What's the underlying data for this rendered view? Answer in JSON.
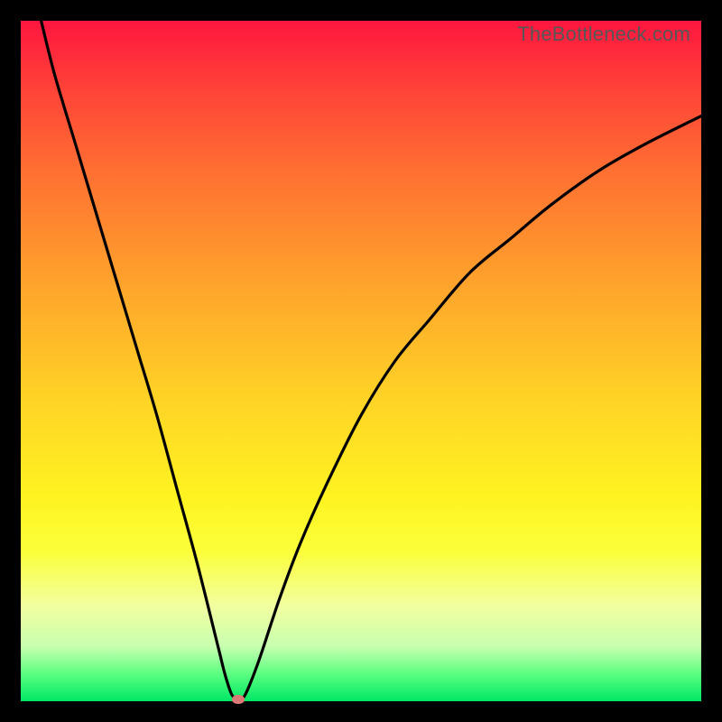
{
  "watermark": "TheBottleneck.com",
  "colors": {
    "frame_bg": "#000000",
    "curve_stroke": "#000000",
    "marker_fill": "#d97a77"
  },
  "chart_data": {
    "type": "line",
    "title": "",
    "xlabel": "",
    "ylabel": "",
    "xlim": [
      0,
      100
    ],
    "ylim": [
      0,
      100
    ],
    "grid": false,
    "legend": false,
    "series": [
      {
        "name": "curve",
        "x": [
          3,
          5,
          8,
          11,
          14,
          17,
          20,
          23,
          26,
          29,
          30,
          31,
          32,
          33,
          35,
          38,
          41,
          45,
          50,
          55,
          60,
          66,
          72,
          78,
          85,
          92,
          100
        ],
        "y": [
          100,
          92,
          82,
          72,
          62,
          52,
          42,
          31,
          20,
          8,
          4,
          1,
          0.3,
          1,
          6,
          15,
          23,
          32,
          42,
          50,
          56,
          63,
          68,
          73,
          78,
          82,
          86
        ]
      }
    ],
    "min_point": {
      "x": 32,
      "y": 0.3
    }
  }
}
